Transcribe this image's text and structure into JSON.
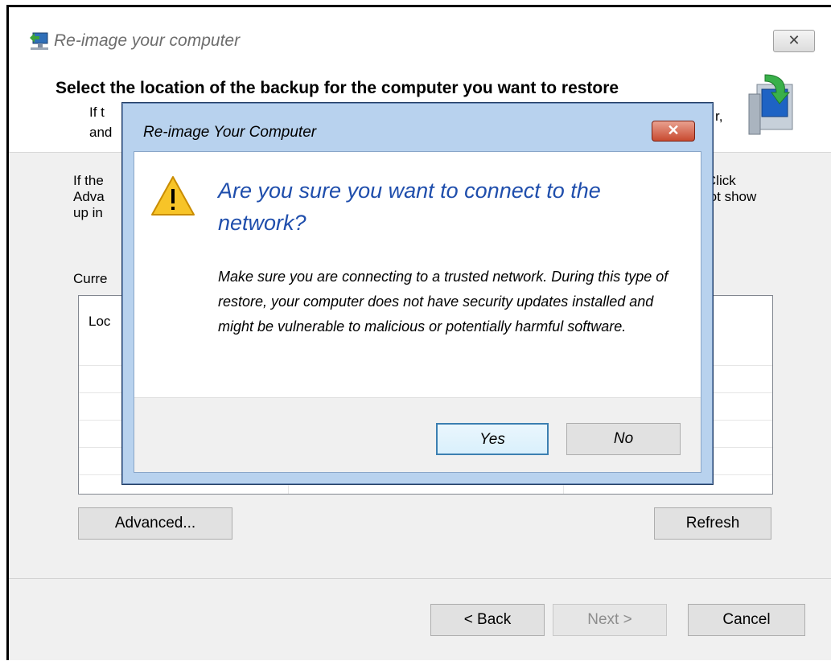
{
  "window": {
    "title": "Re-image your computer",
    "close_glyph": "✕",
    "header": {
      "title": "Select the location of the backup for the computer you want to restore",
      "sub_line1": "If t",
      "sub_line2": "and",
      "sub_right": "r,"
    },
    "body_left": [
      "If the",
      "Adva",
      "up in"
    ],
    "body_right": [
      "p. Click",
      "s not show"
    ],
    "current_label": "Curre",
    "list": {
      "column_head": "Loc"
    },
    "buttons": {
      "advanced": "Advanced...",
      "refresh": "Refresh",
      "back": "< Back",
      "next": "Next >",
      "cancel": "Cancel"
    }
  },
  "modal": {
    "title": "Re-image Your Computer",
    "close_glyph": "✕",
    "heading": "Are you sure you want to connect to the network?",
    "body": "Make sure you are connecting to a trusted network. During this type of restore, your computer does not have security updates installed and might be vulnerable to malicious or potentially harmful software.",
    "yes_label": "Yes",
    "no_label": "No"
  },
  "icons": [
    "computer-restore-icon",
    "warning-icon",
    "close-icon"
  ]
}
